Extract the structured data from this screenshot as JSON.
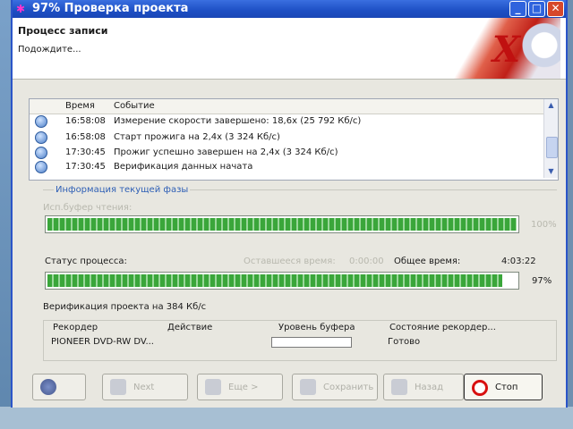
{
  "window": {
    "title": "97% Проверка проекта"
  },
  "header": {
    "title": "Процесс записи",
    "subtitle": "Подождите..."
  },
  "log": {
    "columns": {
      "time": "Время",
      "event": "Событие"
    },
    "rows": [
      {
        "time": "16:58:08",
        "event": "Измерение скорости завершено: 18,6x (25 792 Кб/с)"
      },
      {
        "time": "16:58:08",
        "event": "Старт прожига на 2,4x (3 324 Кб/с)"
      },
      {
        "time": "17:30:45",
        "event": "Прожиг успешно завершен на 2,4x (3 324 Кб/с)"
      },
      {
        "time": "17:30:45",
        "event": "Верификация данных начата"
      }
    ]
  },
  "phase": {
    "legend": "Информация текущей фазы",
    "buffer_label": "Исп.буфер чтения:",
    "buffer_percent": "100%",
    "buffer_fraction": 1.0,
    "status_label": "Статус процесса:",
    "remaining_label": "Оставшееся время:",
    "remaining_value": "0:00:00",
    "total_label": "Общее время:",
    "total_value": "4:03:22",
    "progress_percent": "97%",
    "progress_fraction": 0.97,
    "verify_text": "Верификация проекта на 384 Кб/с"
  },
  "recorders": {
    "columns": {
      "recorder": "Рекордер",
      "action": "Действие",
      "buffer": "Уровень буфера",
      "state": "Состояние рекордер..."
    },
    "rows": [
      {
        "recorder": "PIONEER  DVD-RW  DV...",
        "action": "",
        "state": "Готово"
      }
    ]
  },
  "buttons": {
    "next": "Next",
    "more": "Еще >",
    "save": "Сохранить",
    "back": "Назад",
    "stop": "Стоп"
  },
  "colors": {
    "title_bar": "#1d4fc4",
    "progress": "#3aa63a",
    "legend": "#2e5fb5",
    "stop_icon": "#d81010"
  }
}
